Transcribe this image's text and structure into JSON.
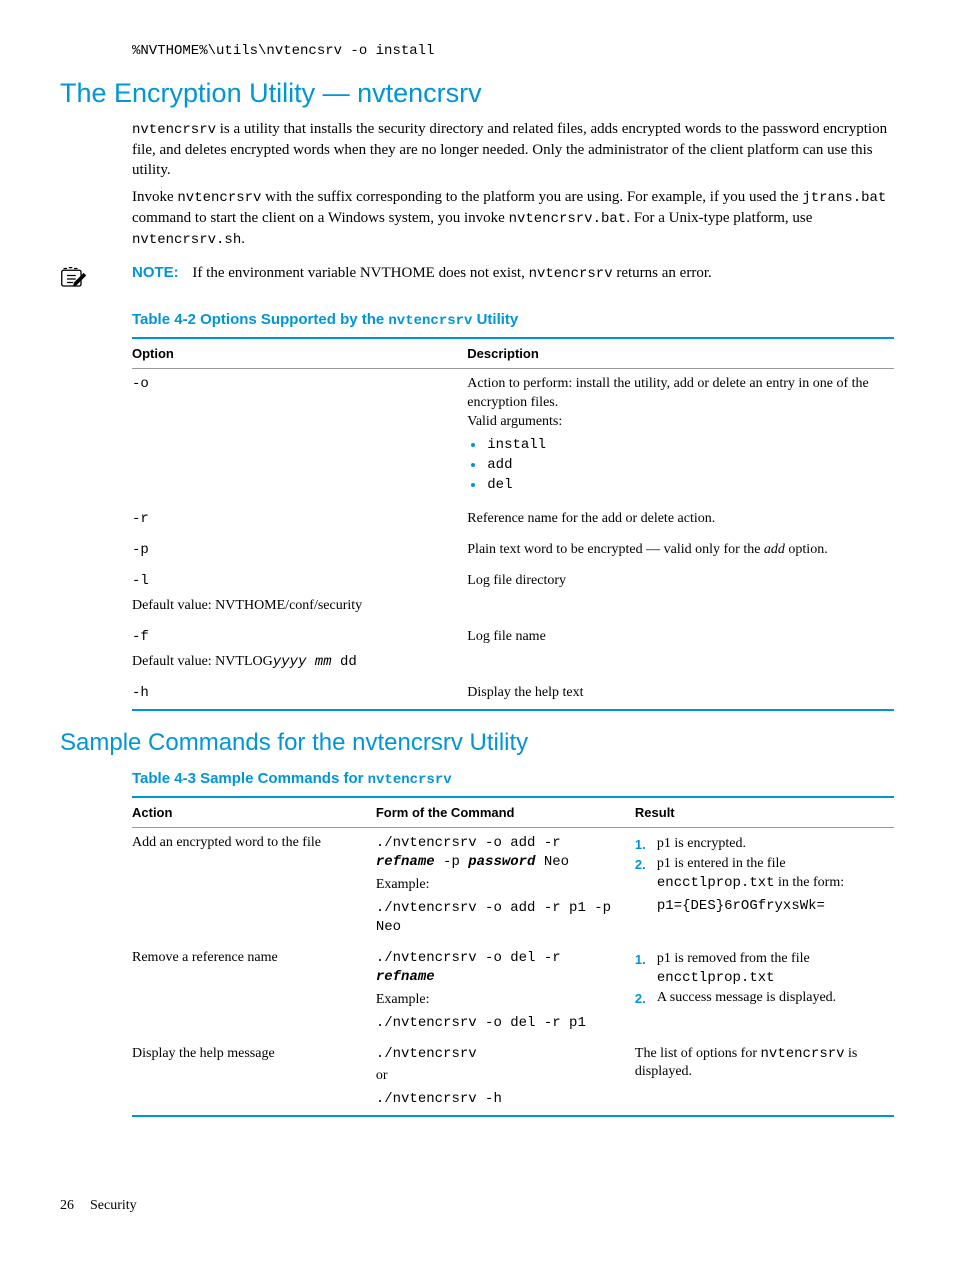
{
  "topCommand": "%NVTHOME%\\utils\\nvtencsrv -o install",
  "h1": "The Encryption Utility — nvtencrsrv",
  "intro": {
    "p1a": "nvtencrsrv",
    "p1b": " is a utility that installs the security directory and related files, adds encrypted words to the password encryption file, and deletes encrypted words when they are no longer needed. Only the administrator of the client platform can use this utility.",
    "p2a": "Invoke ",
    "p2b": "nvtencrsrv",
    "p2c": " with the suffix corresponding to the platform you are using. For example, if you used the ",
    "p2d": "jtrans.bat",
    "p2e": " command to start the client on a Windows system, you invoke ",
    "p2f": "nvtencrsrv.bat",
    "p2g": ". For a Unix-type platform, use ",
    "p2h": "nvtencrsrv.sh",
    "p2i": "."
  },
  "note": {
    "label": "NOTE:",
    "a": "If the environment variable NVTHOME does not exist, ",
    "b": "nvtencrsrv",
    "c": " returns an error."
  },
  "t42": {
    "caption_a": "Table 4-2 Options Supported by the ",
    "caption_b": "nvtencrsrv",
    "caption_c": " Utility",
    "col1": "Option",
    "col2": "Description",
    "rows": {
      "o": {
        "opt": "-o",
        "d1": "Action to perform: install the utility, add or delete an entry in one of the encryption files.",
        "d2": "Valid arguments:",
        "a1": "install",
        "a2": "add",
        "a3": "del"
      },
      "r": {
        "opt": "-r",
        "desc": "Reference name for the add or delete action."
      },
      "p": {
        "opt": "-p",
        "da": "Plain text word to be encrypted — valid only for the ",
        "db": "add",
        "dc": " option."
      },
      "l": {
        "opt": "-l",
        "desc": "Log file directory",
        "defa": "Default value: NVTHOME/conf/security"
      },
      "f": {
        "opt": "-f",
        "desc": "Log file name",
        "defa": "Default value: NVTLOG",
        "defb": "yyyy mm ",
        "defc": "dd"
      },
      "h": {
        "opt": "-h",
        "desc": "Display the help text"
      }
    }
  },
  "h2": "Sample Commands for the nvtencrsrv Utility",
  "t43": {
    "caption_a": "Table 4-3 Sample Commands for ",
    "caption_b": "nvtencrsrv",
    "col1": "Action",
    "col2": "Form of the Command",
    "col3": "Result",
    "rows": {
      "add": {
        "action": "Add an encrypted word to the file",
        "cmd_a": "./nvtencrsrv -o add -r ",
        "cmd_b": "refname",
        "cmd_c": " -p ",
        "cmd_d": "password",
        "cmd_e": " Neo",
        "ex_label": "Example:",
        "ex_cmd": "./nvtencrsrv -o add -r p1 -p Neo",
        "r1": "p1 is encrypted.",
        "r2a": "p1 is entered in the file ",
        "r2b": "encctlprop.txt",
        "r2c": " in the form:",
        "r2d": "p1={DES}6rOGfryxsWk="
      },
      "del": {
        "action": "Remove a reference name",
        "cmd_a": "./nvtencrsrv -o del -r ",
        "cmd_b": "refname",
        "ex_label": "Example:",
        "ex_cmd": "./nvtencrsrv -o del -r p1",
        "r1a": "p1 is removed from the file ",
        "r1b": "encctlprop.txt",
        "r2": "A success message is displayed."
      },
      "help": {
        "action": "Display the help message",
        "cmd_a": "./nvtencrsrv",
        "or": "or",
        "cmd_b": "./nvtencrsrv -h",
        "ra": "The list of options for ",
        "rb": "nvtencrsrv",
        "rc": " is displayed."
      }
    }
  },
  "footer": {
    "page": "26",
    "section": "Security"
  }
}
